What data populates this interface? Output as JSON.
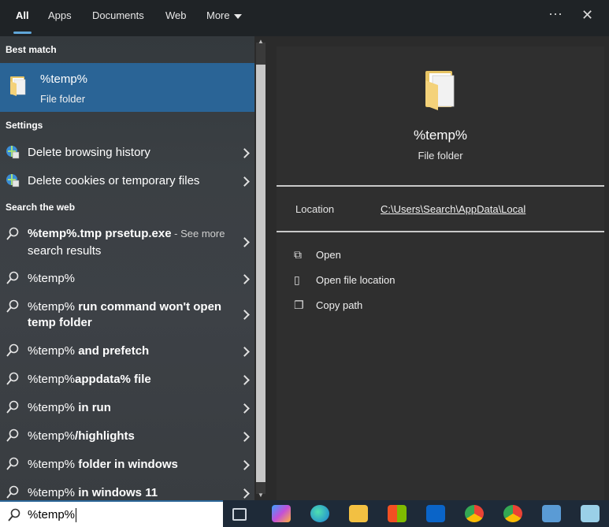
{
  "tabs": [
    {
      "label": "All"
    },
    {
      "label": "Apps"
    },
    {
      "label": "Documents"
    },
    {
      "label": "Web"
    },
    {
      "label": "More"
    }
  ],
  "top_actions": {
    "more": "···",
    "close": "✕"
  },
  "best_match": {
    "header": "Best match",
    "title": "%temp%",
    "subtitle": "File folder"
  },
  "settings": {
    "header": "Settings",
    "items": [
      {
        "label": "Delete browsing history"
      },
      {
        "label": "Delete cookies or temporary files"
      }
    ]
  },
  "web": {
    "header": "Search the web",
    "items": [
      {
        "prefix": "%temp%",
        "bold": ".tmp prsetup.exe",
        "suffix": " - See more",
        "line2": "search results"
      },
      {
        "prefix": "%temp%",
        "bold": ""
      },
      {
        "prefix": "%temp%",
        "bold": " run command won't open",
        "line2": "temp folder"
      },
      {
        "prefix": "%temp%",
        "bold": " and prefetch"
      },
      {
        "prefix": "%temp%",
        "bold": "appdata% file"
      },
      {
        "prefix": "%temp%",
        "bold": " in run"
      },
      {
        "prefix": "%temp%",
        "bold": "/highlights"
      },
      {
        "prefix": "%temp%",
        "bold": " folder in windows"
      },
      {
        "prefix": "%temp%",
        "bold": " in windows 11"
      }
    ]
  },
  "detail": {
    "title": "%temp%",
    "subtitle": "File folder",
    "location_label": "Location",
    "location_value": "C:\\Users\\Search\\AppData\\Local",
    "actions": [
      {
        "label": "Open",
        "icon": "open-icon"
      },
      {
        "label": "Open file location",
        "icon": "file-location-icon"
      },
      {
        "label": "Copy path",
        "icon": "copy-icon"
      }
    ]
  },
  "search": {
    "value": "%temp%"
  },
  "taskbar": {
    "icons": [
      "task-view-icon",
      "copilot-icon",
      "edge-icon",
      "file-explorer-icon",
      "store-icon",
      "outlook-icon",
      "chrome-icon",
      "chrome-profile-icon",
      "remote-desktop-icon",
      "notepad-icon"
    ]
  },
  "colors": {
    "accent": "#2a6496",
    "tab_indicator": "#60a6d8"
  }
}
